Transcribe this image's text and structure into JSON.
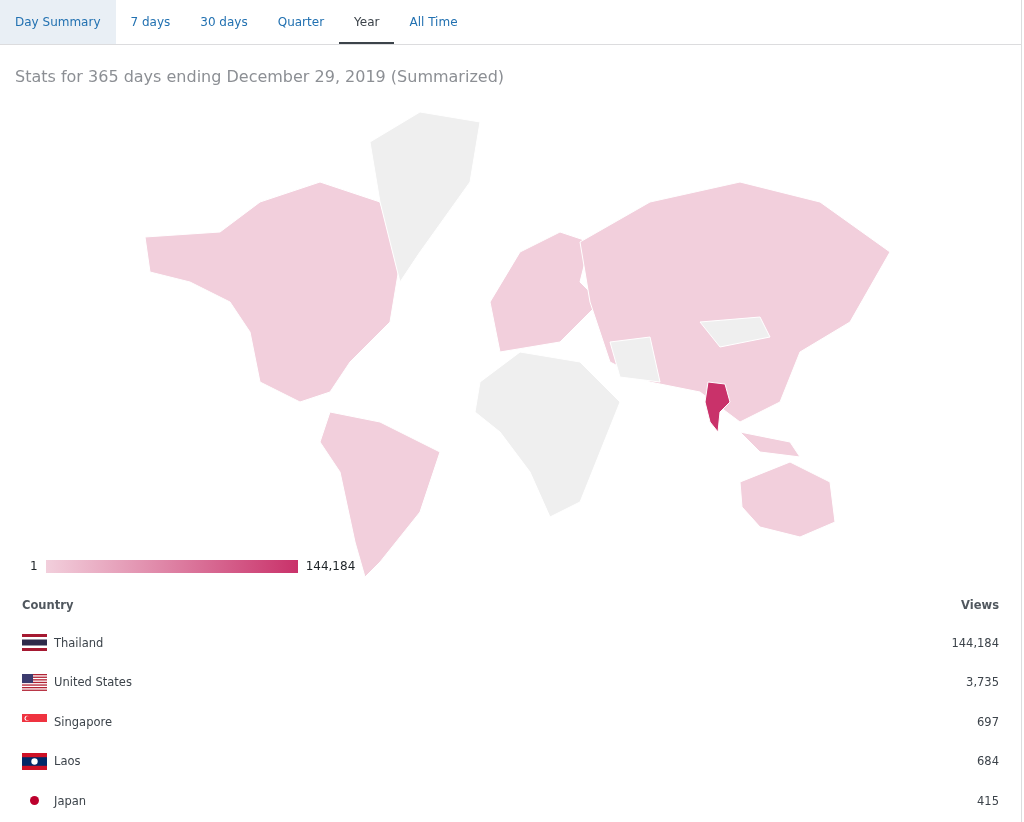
{
  "tabs": [
    {
      "label": "Day Summary",
      "selected": false,
      "hovered": true
    },
    {
      "label": "7 days",
      "selected": false,
      "hovered": false
    },
    {
      "label": "30 days",
      "selected": false,
      "hovered": false
    },
    {
      "label": "Quarter",
      "selected": false,
      "hovered": false
    },
    {
      "label": "Year",
      "selected": true,
      "hovered": false
    },
    {
      "label": "All Time",
      "selected": false,
      "hovered": false
    }
  ],
  "title": "Stats for 365 days ending December 29, 2019 (Summarized)",
  "legend": {
    "min": "1",
    "max": "144,184"
  },
  "table": {
    "columns": [
      "Country",
      "Views"
    ],
    "rows": [
      {
        "country": "Thailand",
        "views": "144,184",
        "kind": "thailand"
      },
      {
        "country": "United States",
        "views": "3,735",
        "kind": "usa"
      },
      {
        "country": "Singapore",
        "views": "697",
        "kind": "singapore"
      },
      {
        "country": "Laos",
        "views": "684",
        "kind": "laos"
      },
      {
        "country": "Japan",
        "views": "415",
        "kind": "japan"
      }
    ]
  }
}
